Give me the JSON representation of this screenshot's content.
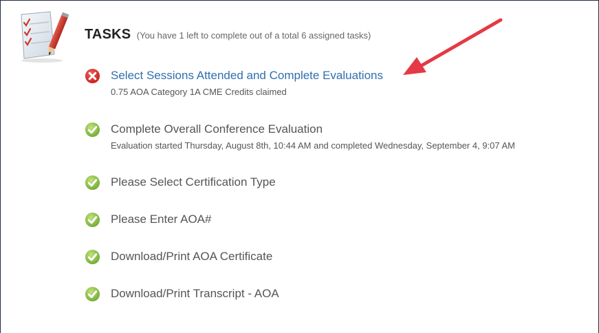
{
  "header": {
    "title": "TASKS",
    "subtitle": "(You have 1 left to complete out of a total 6 assigned tasks)"
  },
  "tasks": [
    {
      "status": "incomplete",
      "status_icon": "x-circle-icon",
      "title": "Select Sessions Attended and Complete Evaluations",
      "detail": "0.75 AOA Category 1A CME Credits claimed"
    },
    {
      "status": "complete",
      "status_icon": "check-circle-icon",
      "title": "Complete Overall Conference Evaluation",
      "detail": "Evaluation started Thursday, August 8th, 10:44 AM and completed Wednesday, September 4, 9:07 AM"
    },
    {
      "status": "complete",
      "status_icon": "check-circle-icon",
      "title": "Please Select Certification Type"
    },
    {
      "status": "complete",
      "status_icon": "check-circle-icon",
      "title": "Please Enter AOA#"
    },
    {
      "status": "complete",
      "status_icon": "check-circle-icon",
      "title": "Download/Print AOA Certificate"
    },
    {
      "status": "complete",
      "status_icon": "check-circle-icon",
      "title": "Download/Print Transcript - AOA"
    }
  ],
  "colors": {
    "link": "#2f6fae",
    "incomplete_red": "#d32f2f",
    "complete_green": "#8bc34a",
    "annotation_arrow": "#e53945",
    "text": "#555555",
    "border": "#1f2a44"
  },
  "icons": {
    "logo": "checklist-pencil-icon",
    "annotation": "red-arrow-icon"
  }
}
